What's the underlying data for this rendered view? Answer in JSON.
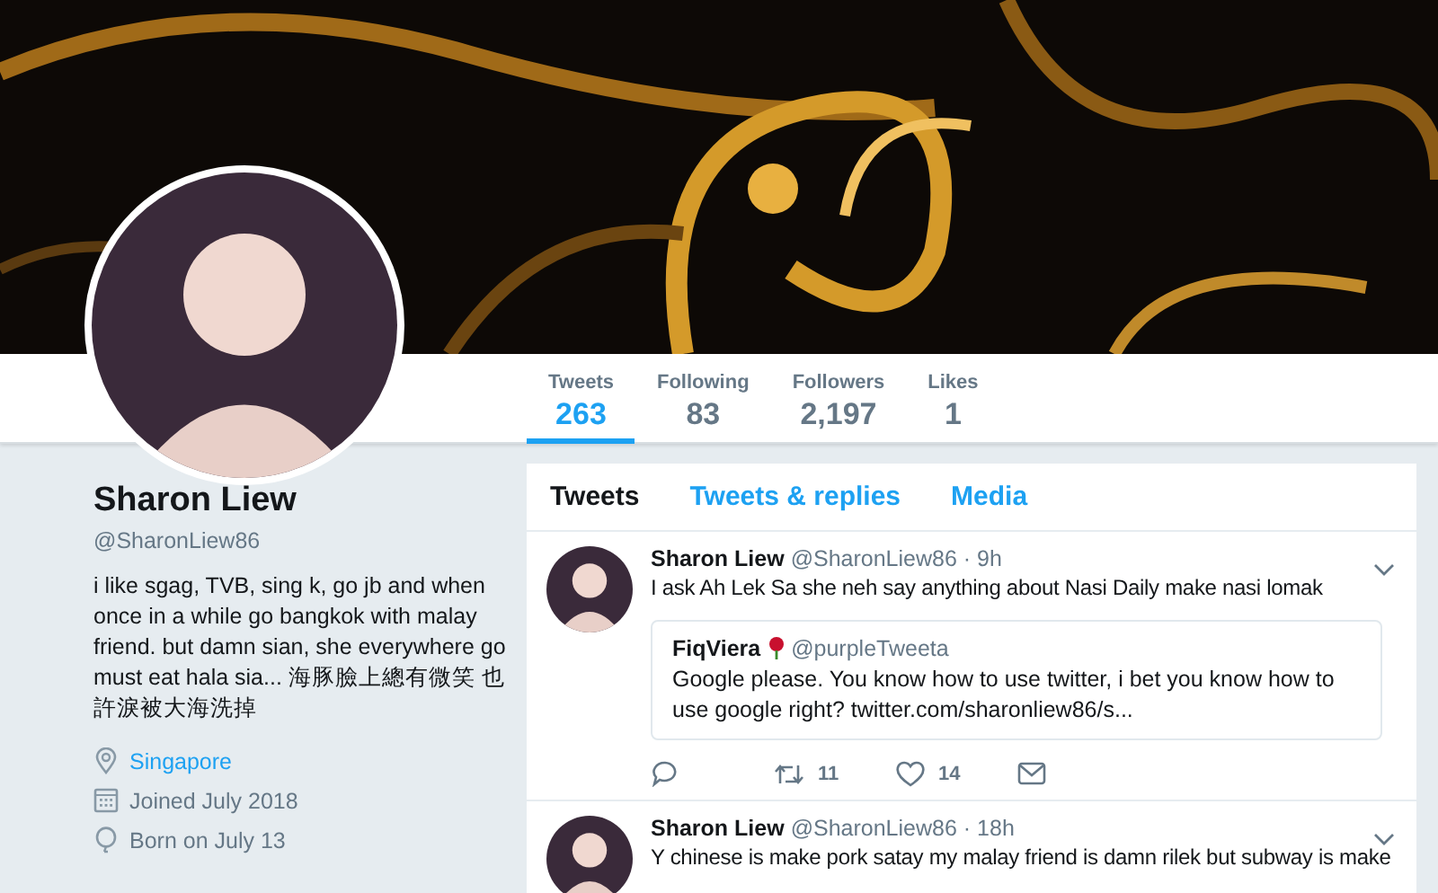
{
  "profile": {
    "name": "Sharon Liew",
    "handle": "@SharonLiew86",
    "bio": "i like sgag, TVB, sing k, go jb and when once in a while go bangkok with malay friend. but damn sian, she everywhere go must eat hala sia... 海豚臉上總有微笑 也許淚被大海洗掉",
    "location": "Singapore",
    "joined": "Joined July 2018",
    "born": "Born on July 13"
  },
  "stats": [
    {
      "label": "Tweets",
      "value": "263",
      "selected": true
    },
    {
      "label": "Following",
      "value": "83",
      "selected": false
    },
    {
      "label": "Followers",
      "value": "2,197",
      "selected": false
    },
    {
      "label": "Likes",
      "value": "1",
      "selected": false
    }
  ],
  "timeline_tabs": [
    {
      "label": "Tweets",
      "selected": true
    },
    {
      "label": "Tweets & replies",
      "selected": false
    },
    {
      "label": "Media",
      "selected": false
    }
  ],
  "tweets": [
    {
      "name": "Sharon Liew",
      "handle": "@SharonLiew86",
      "time": "· 9h",
      "text": "I ask Ah Lek Sa she neh say anything about Nasi Daily make nasi  lomak",
      "quote": {
        "name": "FiqViera",
        "handle": "@purpleTweeta",
        "text": "Google please. You know how to use twitter, i bet you know how to use google right? twitter.com/sharonliew86/s..."
      },
      "retweets": "11",
      "likes": "14"
    },
    {
      "name": "Sharon Liew",
      "handle": "@SharonLiew86",
      "time": "· 18h",
      "text": "Y chinese is make pork satay my malay friend is damn rilek but subway is make"
    }
  ]
}
